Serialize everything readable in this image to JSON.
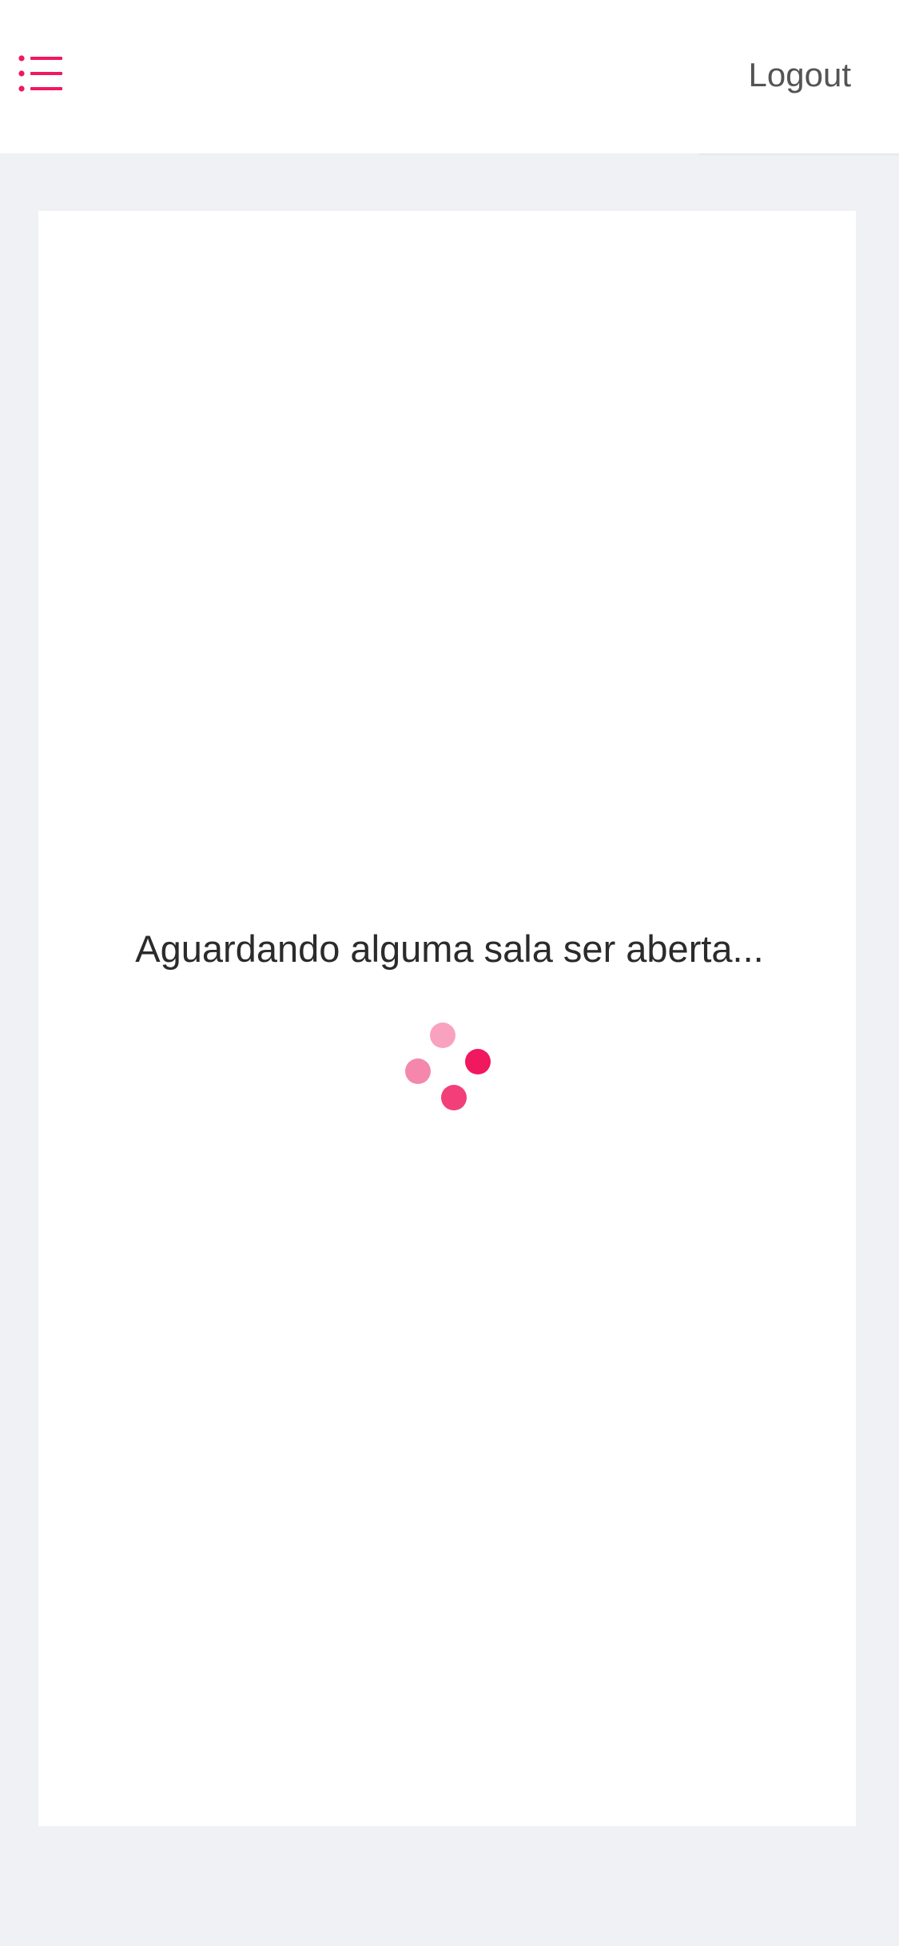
{
  "header": {
    "menu_icon": "list-icon",
    "logout_label": "Logout"
  },
  "main": {
    "status_text": "Aguardando alguma sala ser aberta...",
    "spinner_icon": "loading-dots-icon"
  },
  "colors": {
    "accent": "#f0185f",
    "background": "#f0f1f5",
    "card": "#ffffff",
    "text": "#2b2b2b",
    "logout_text": "#545454"
  }
}
